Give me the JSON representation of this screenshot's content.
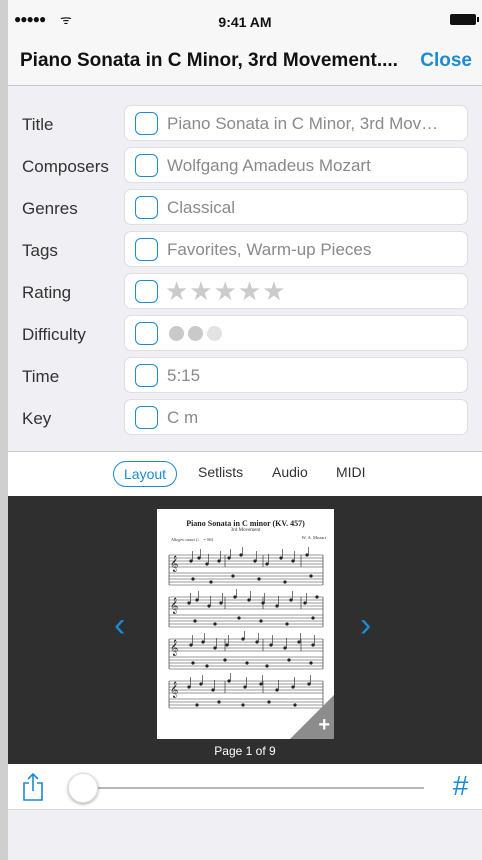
{
  "status": {
    "signal": "●●●●●",
    "wifi": "ᯤ",
    "time": "9:41 AM"
  },
  "navbar": {
    "title": "Piano Sonata in C Minor, 3rd Movement....",
    "close_label": "Close"
  },
  "form": {
    "title_label": "Title",
    "title_value": "Piano Sonata in C Minor, 3rd Mov…",
    "composers_label": "Composers",
    "composers_value": "Wolfgang Amadeus Mozart",
    "genres_label": "Genres",
    "genres_value": "Classical",
    "tags_label": "Tags",
    "tags_value": "Favorites, Warm-up Pieces",
    "rating_label": "Rating",
    "rating_stars": "★★★★★",
    "rating_value": 0,
    "difficulty_label": "Difficulty",
    "difficulty_colors": [
      "#c9c9c9",
      "#c9c9c9",
      "#e3e3e3"
    ],
    "difficulty_value": 2,
    "time_label": "Time",
    "time_value": "5:15",
    "key_label": "Key",
    "key_value": "C m"
  },
  "tabs": {
    "layout": "Layout",
    "setlists": "Setlists",
    "audio": "Audio",
    "midi": "MIDI",
    "active": "Layout"
  },
  "viewer": {
    "prev_icon": "chevron-left-icon",
    "next_icon": "chevron-right-icon",
    "prev_glyph": "‹",
    "next_glyph": "›",
    "score_title": "Piano Sonata in C minor (KV. 457)",
    "score_subtitle": "3rd Movement",
    "score_composer": "W. A. Mozart",
    "score_tempo": "Allegro assai (♩ = 96)",
    "add_glyph": "+",
    "page_label": "Page 1 of 9"
  },
  "toolbar": {
    "share_icon": "share-icon",
    "hash_glyph": "#",
    "slider_value": 0
  },
  "colors": {
    "accent": "#1a8bd4",
    "viewer_bg": "#2f2f2f",
    "form_bg": "#efeff4"
  }
}
